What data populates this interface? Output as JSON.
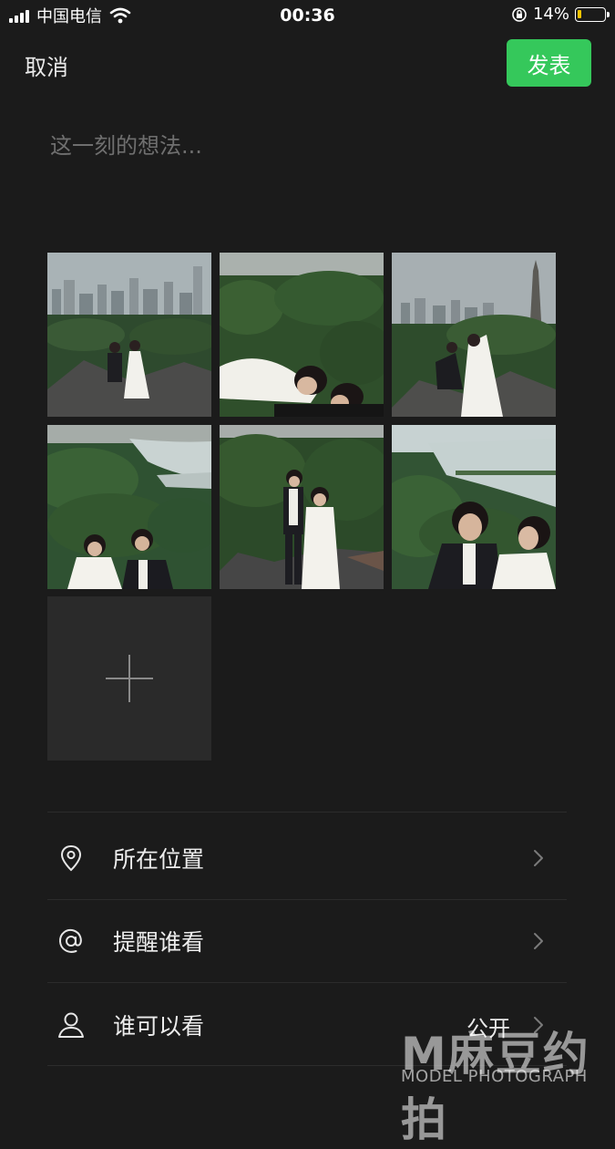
{
  "status_bar": {
    "carrier": "中国电信",
    "time": "00:36",
    "battery_percent": "14%",
    "battery_level": 0.14
  },
  "nav": {
    "cancel_label": "取消",
    "publish_label": "发表"
  },
  "composer": {
    "placeholder": "这一刻的想法..."
  },
  "options": {
    "location": {
      "label": "所在位置",
      "icon": "location-pin-icon"
    },
    "mention": {
      "label": "提醒谁看",
      "icon": "at-icon"
    },
    "visibility": {
      "label": "谁可以看",
      "value": "公开",
      "icon": "person-icon"
    }
  },
  "watermark": {
    "logo": "M麻豆约拍",
    "subtitle": "MODEL PHOTOGRAPH"
  },
  "colors": {
    "publish_green": "#35c85b",
    "background": "#1b1b1b"
  }
}
